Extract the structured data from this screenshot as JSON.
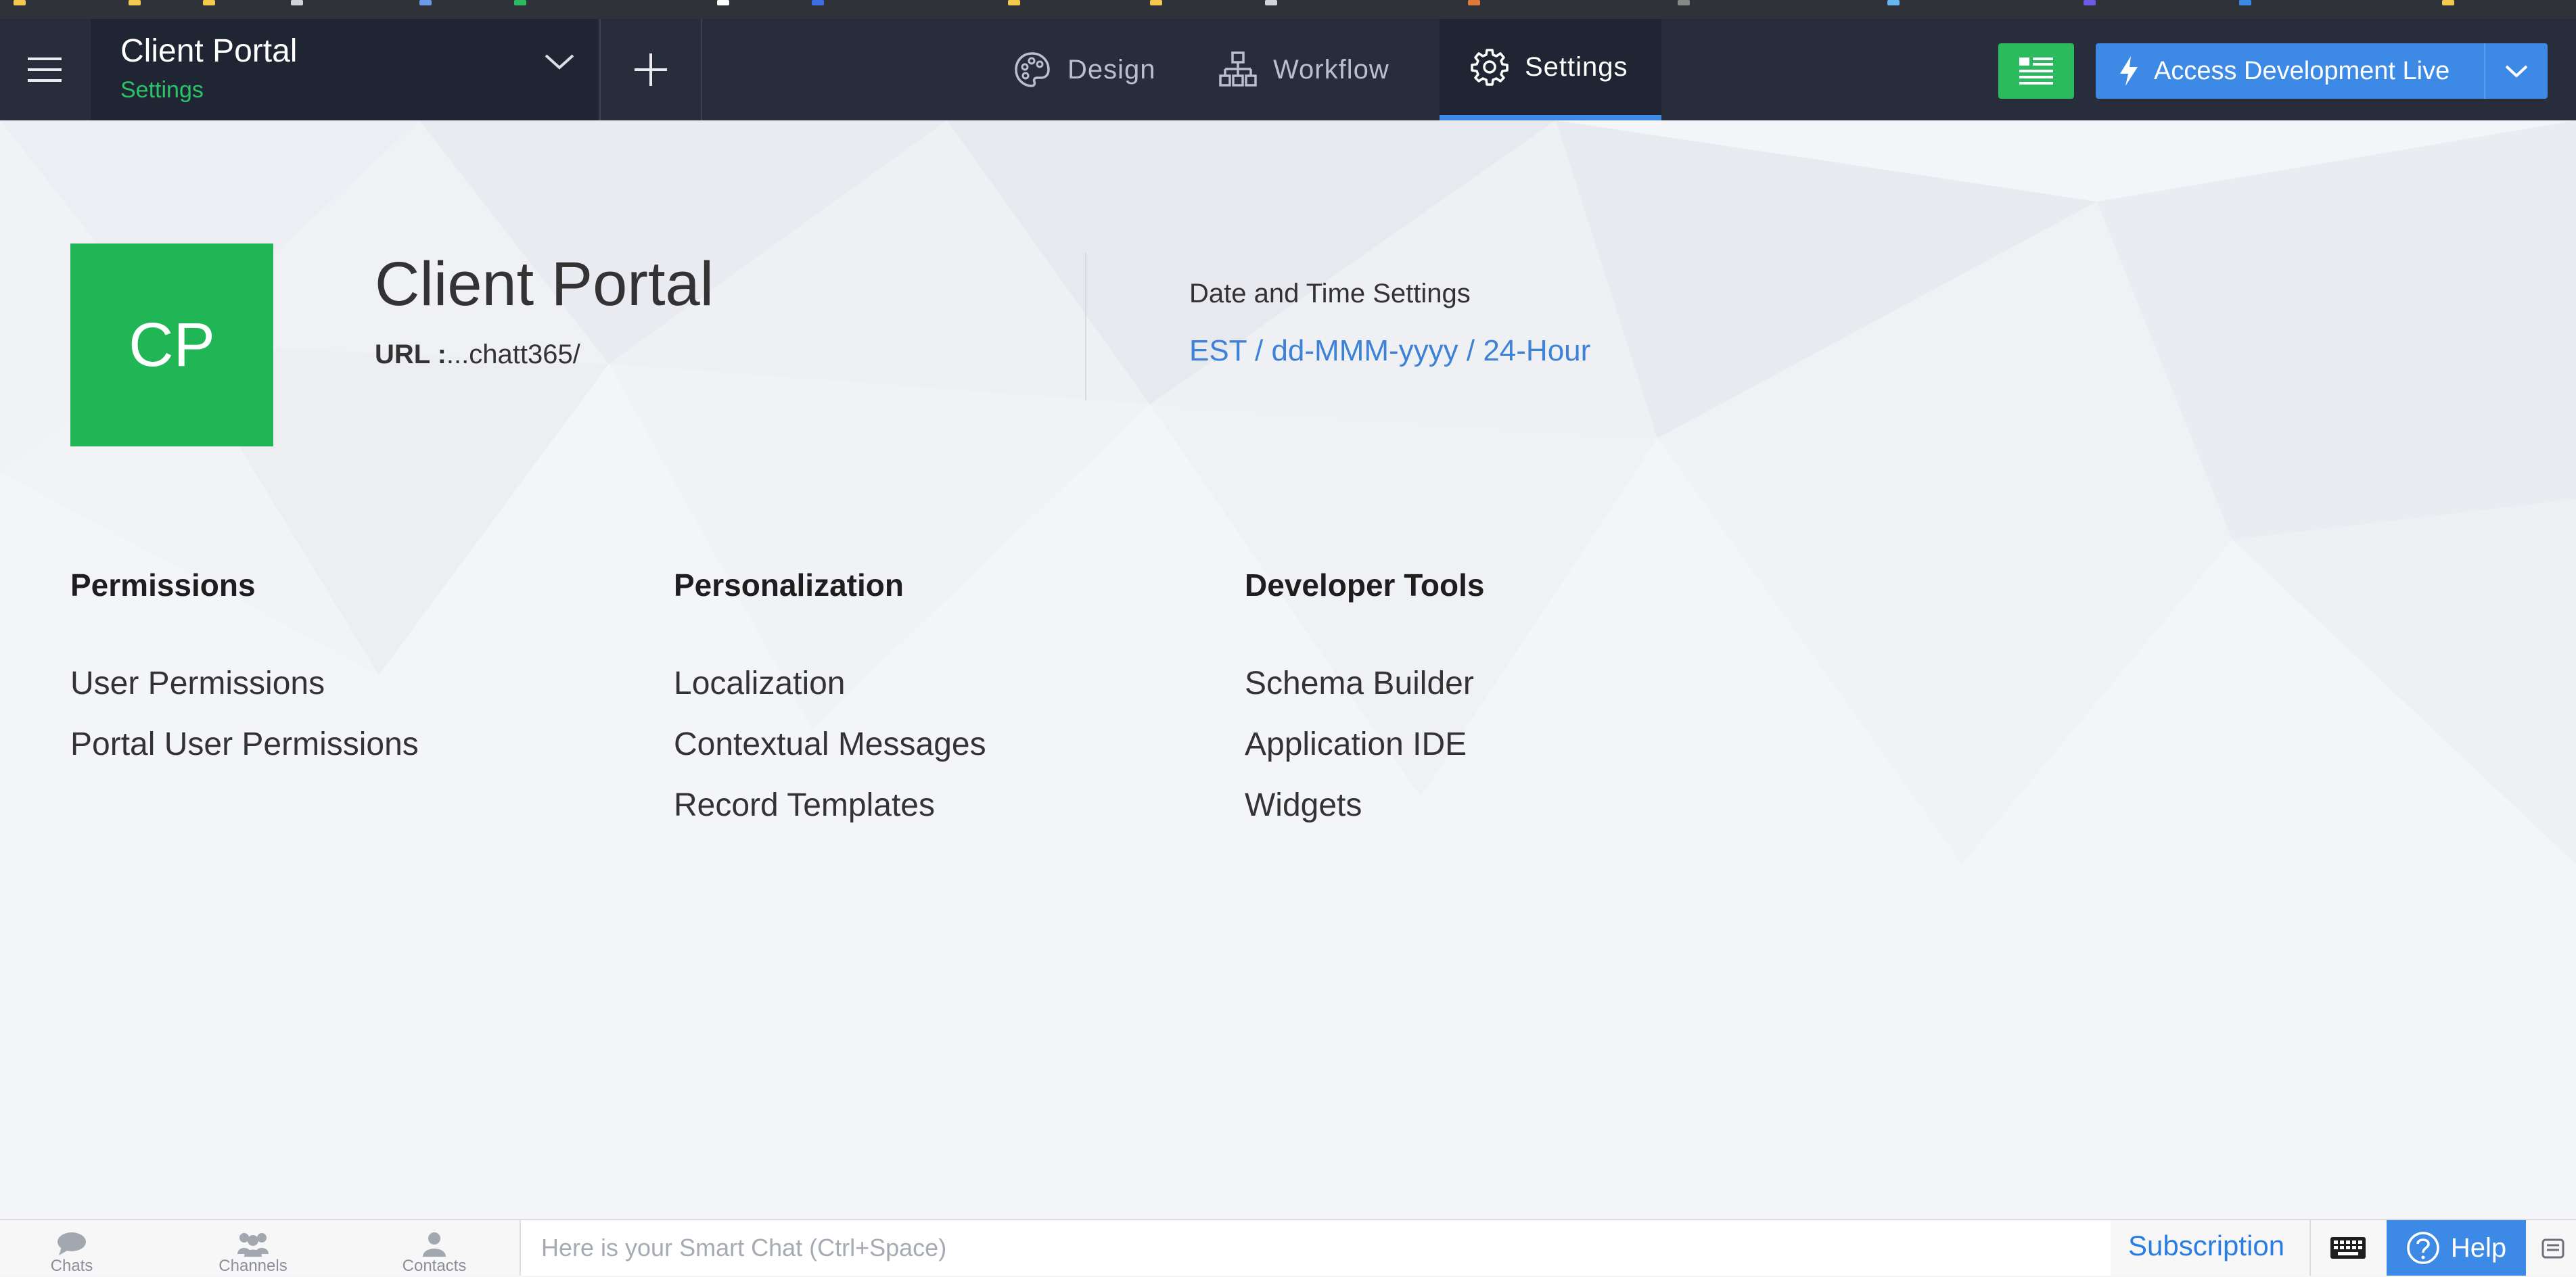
{
  "header": {
    "app_name": "Client Portal",
    "app_subtitle": "Settings",
    "tabs": [
      {
        "label": "Design",
        "icon": "palette-icon",
        "active": false
      },
      {
        "label": "Workflow",
        "icon": "workflow-icon",
        "active": false
      },
      {
        "label": "Settings",
        "icon": "gear-icon",
        "active": true
      }
    ],
    "live_button_label": "Access Development Live"
  },
  "app_info": {
    "logo_initials": "CP",
    "title": "Client Portal",
    "url_label": "URL :",
    "url_value": "...chatt365/",
    "datetime_label": "Date and Time Settings",
    "datetime_value": "EST / dd-MMM-yyyy / 24-Hour"
  },
  "sections": {
    "permissions": {
      "title": "Permissions",
      "links": [
        "User Permissions",
        "Portal User Permissions"
      ]
    },
    "personalization": {
      "title": "Personalization",
      "links": [
        "Localization",
        "Contextual Messages",
        "Record Templates"
      ]
    },
    "developer_tools": {
      "title": "Developer Tools",
      "links": [
        "Schema Builder",
        "Application IDE",
        "Widgets"
      ]
    }
  },
  "bottom_bar": {
    "chats": "Chats",
    "channels": "Channels",
    "contacts": "Contacts",
    "smart_chat_placeholder": "Here is your Smart Chat (Ctrl+Space)",
    "subscription": "Subscription",
    "help": "Help"
  },
  "colors": {
    "topbar": "#272d3b",
    "accent_blue": "#3d8ae6",
    "accent_green": "#20b655",
    "link_blue": "#3d82d6"
  }
}
